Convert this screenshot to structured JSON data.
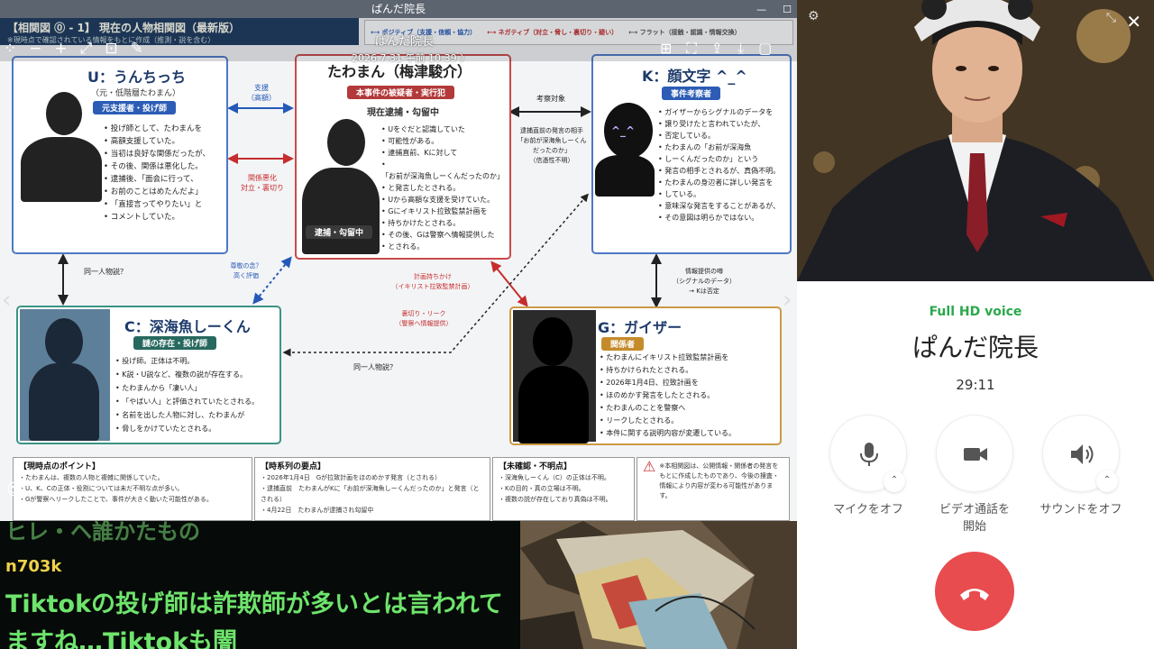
{
  "viewer": {
    "title": "ぱんだ院長",
    "name_overlay": "ぱんだ院長",
    "date_overlay": "2026.7.31 午前 10:39 〉"
  },
  "diagram": {
    "top_title": "【相関図 ⓪ - 1】 現在の人物相関図（最新版）",
    "top_note": "※現時点で確認されている情報をもとに作成（推測・説を含む）",
    "legend": {
      "blue": "ポジティブ（支援・信頼・協力）",
      "red": "ネガティブ（対立・脅し・裏切り・疑い）",
      "gray": "フラット（接触・認識・情報交換）"
    },
    "u": {
      "title": "U：うんちっち",
      "sub": "（元・低階層たわまん）",
      "tag": "元支援者・投げ師",
      "lines": [
        "投げ師として、たわまんを",
        "高額支援していた。",
        "当初は良好な関係だったが、",
        "その後、関係は悪化した。",
        "逮捕後、「面会に行って、",
        "お前のことはめたんだよ」",
        "「直接言ってやりたい」と",
        "コメントしていた。"
      ]
    },
    "tawa": {
      "title": "たわまん（梅津駿介）",
      "tag": "本事件の被疑者・実行犯",
      "status": "現在逮捕・勾留中",
      "badge": "逮捕・勾留中",
      "lines": [
        "Uをぐだと認識していた",
        "可能性がある。",
        "逮捕直前、Kに対して",
        "「お前が深海魚しーくんだったのか」",
        "と発言したとされる。",
        "Uから高額な支援を受けていた。",
        "Gにイキリスト拉致監禁計画を",
        "持ちかけたとされる。",
        "その後、Gは警察へ情報提供した",
        "とされる。"
      ]
    },
    "k": {
      "title": "K：顔文字 ^_^",
      "tag": "事件考察者",
      "face": "^_^",
      "lines": [
        "ガイザーからシグナルのデータを",
        "譲り受けたと言われていたが、",
        "否定している。",
        "たわまんの「お前が深海魚",
        "しーくんだったのか」という",
        "発言の相手とされるが、真偽不明。",
        "たわまんの身辺者に詳しい発言を",
        "している。",
        "意味深な発言をすることがあるが、",
        "その意図は明らかではない。"
      ]
    },
    "c": {
      "title": "C：深海魚しーくん",
      "tag": "謎の存在・投げ師",
      "lines": [
        "投げ師。正体は不明。",
        "K説・U説など、複数の説が存在する。",
        "たわまんから「凄い人」",
        "「やばい人」と評価されていたとされる。",
        "名前を出した人物に対し、たわまんが",
        "脅しをかけていたとされる。"
      ]
    },
    "g": {
      "title": "G：ガイザー",
      "tag": "関係者",
      "lines": [
        "たわまんにイキリスト拉致監禁計画を",
        "持ちかけられたとされる。",
        "2026年1月4日、拉致計画を",
        "ほのめかす発言をしたとされる。",
        "たわまんのことを警察へ",
        "リークしたとされる。",
        "本件に関する説明内容が変遷している。"
      ]
    },
    "labels": {
      "support": "支援\n（高額）",
      "conflict": "関係悪化\n対立・裏切り",
      "consider": "考察対象",
      "consider_note": "逮捕直前の発言の相手\n「お前が深海魚しーくん\nだったのか」\n（信憑性不明）",
      "same1": "同一人物説？",
      "respect": "尊敬の念？\n高く評価",
      "plan": "計画持ちかけ\n（イキリスト拉致監禁計画）",
      "betray": "裏切り・リーク\n（警察へ情報提供）",
      "info": "情報提供の噂\n（シグナルのデータ）\n→ Kは否定",
      "same2": "同一人物説？"
    },
    "bottom": {
      "p1h": "【現時点のポイント】",
      "p1": "・たわまんは、複数の人物と複雑に関係していた。\n・U、K、Cの正体・役割については未だ不明な点が多い。\n・Gが警察へリークしたことで、事件が大きく動いた可能性がある。",
      "p2h": "【時系列の要点】",
      "p2": "・2026年1月4日　Gが拉致計画をほのめかす発言（とされる）\n・逮捕直前　たわまんがKに「お前が深海魚しーくんだったのか」と発言（とされる）\n・4月22日　たわまんが逮捕され勾留中",
      "p3h": "【未確認・不明点】",
      "p3": "・深海魚しーくん（C）の正体は不明。\n・Kの目的・真の立場は不明。\n・複数の説が存在しており真偽は不明。",
      "p4": "※本相関図は、公開情報・関係者の発言をもとに作成したものであり、今後の捜査・情報により内容が変わる可能性があります。"
    }
  },
  "chat": {
    "cut_line": "ヒレ・ヘ誰かたもの",
    "user": "n703k",
    "message": "Tiktokの投げ師は詐欺師が多いとは言われてますね…Tiktokも闇"
  },
  "call": {
    "quality": "Full HD voice",
    "name": "ぱんだ院長",
    "timer": "29:11",
    "mic_label": "マイクをオフ",
    "video_label": "ビデオ通話を\n開始",
    "sound_label": "サウンドをオフ"
  }
}
